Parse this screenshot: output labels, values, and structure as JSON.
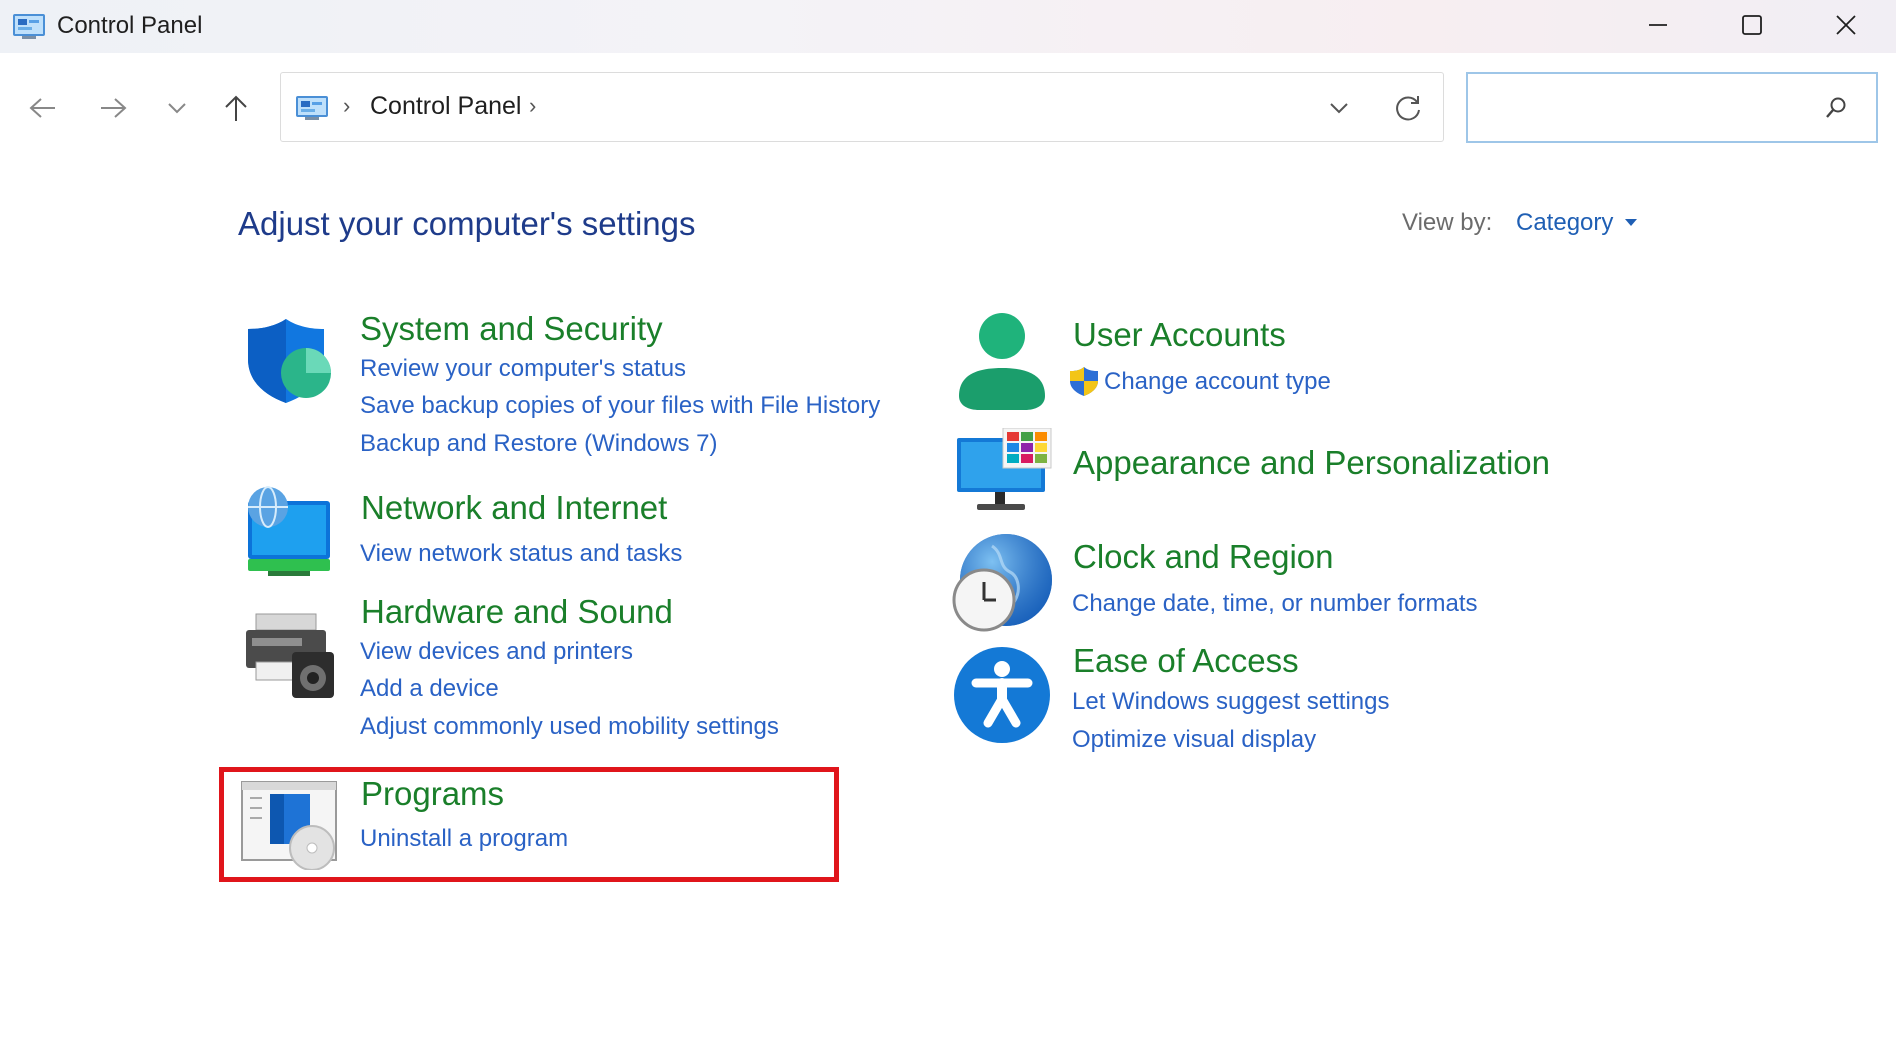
{
  "window": {
    "title": "Control Panel",
    "icons": {
      "app": "control-panel-icon",
      "minimize": "minimize-icon",
      "maximize": "maximize-icon",
      "close": "close-icon"
    }
  },
  "nav": {
    "icons": {
      "back": "arrow-left-icon",
      "forward": "arrow-right-icon",
      "recent": "chevron-down-icon",
      "up": "arrow-up-icon"
    }
  },
  "address": {
    "crumb": "Control Panel",
    "separator": "›",
    "icons": {
      "dropdown": "chevron-down-icon",
      "refresh": "refresh-icon"
    }
  },
  "search": {
    "value": "",
    "placeholder": "",
    "icon": "search-icon"
  },
  "main": {
    "title": "Adjust your computer's settings",
    "view_by_label": "View by:",
    "view_by_value": "Category",
    "categories_left": [
      {
        "title": "System and Security",
        "icon": "shield-icon",
        "links": [
          "Review your computer's status",
          "Save backup copies of your files with File History",
          "Backup and Restore (Windows 7)"
        ]
      },
      {
        "title": "Network and Internet",
        "icon": "network-globe-icon",
        "links": [
          "View network status and tasks"
        ]
      },
      {
        "title": "Hardware and Sound",
        "icon": "printer-speaker-icon",
        "links": [
          "View devices and printers",
          "Add a device",
          "Adjust commonly used mobility settings"
        ]
      },
      {
        "title": "Programs",
        "icon": "programs-disc-icon",
        "links": [
          "Uninstall a program"
        ]
      }
    ],
    "categories_right": [
      {
        "title": "User Accounts",
        "icon": "user-icon",
        "links": [
          "Change account type"
        ],
        "link_icon": "uac-shield-icon"
      },
      {
        "title": "Appearance and Personalization",
        "icon": "monitor-palette-icon",
        "links": []
      },
      {
        "title": "Clock and Region",
        "icon": "clock-globe-icon",
        "links": [
          "Change date, time, or number formats"
        ]
      },
      {
        "title": "Ease of Access",
        "icon": "accessibility-icon",
        "links": [
          "Let Windows suggest settings",
          "Optimize visual display"
        ]
      }
    ]
  },
  "colors": {
    "category_title": "#1a7f2a",
    "link": "#2a62c5",
    "page_title": "#1e3b8a",
    "highlight": "#e0151b"
  }
}
